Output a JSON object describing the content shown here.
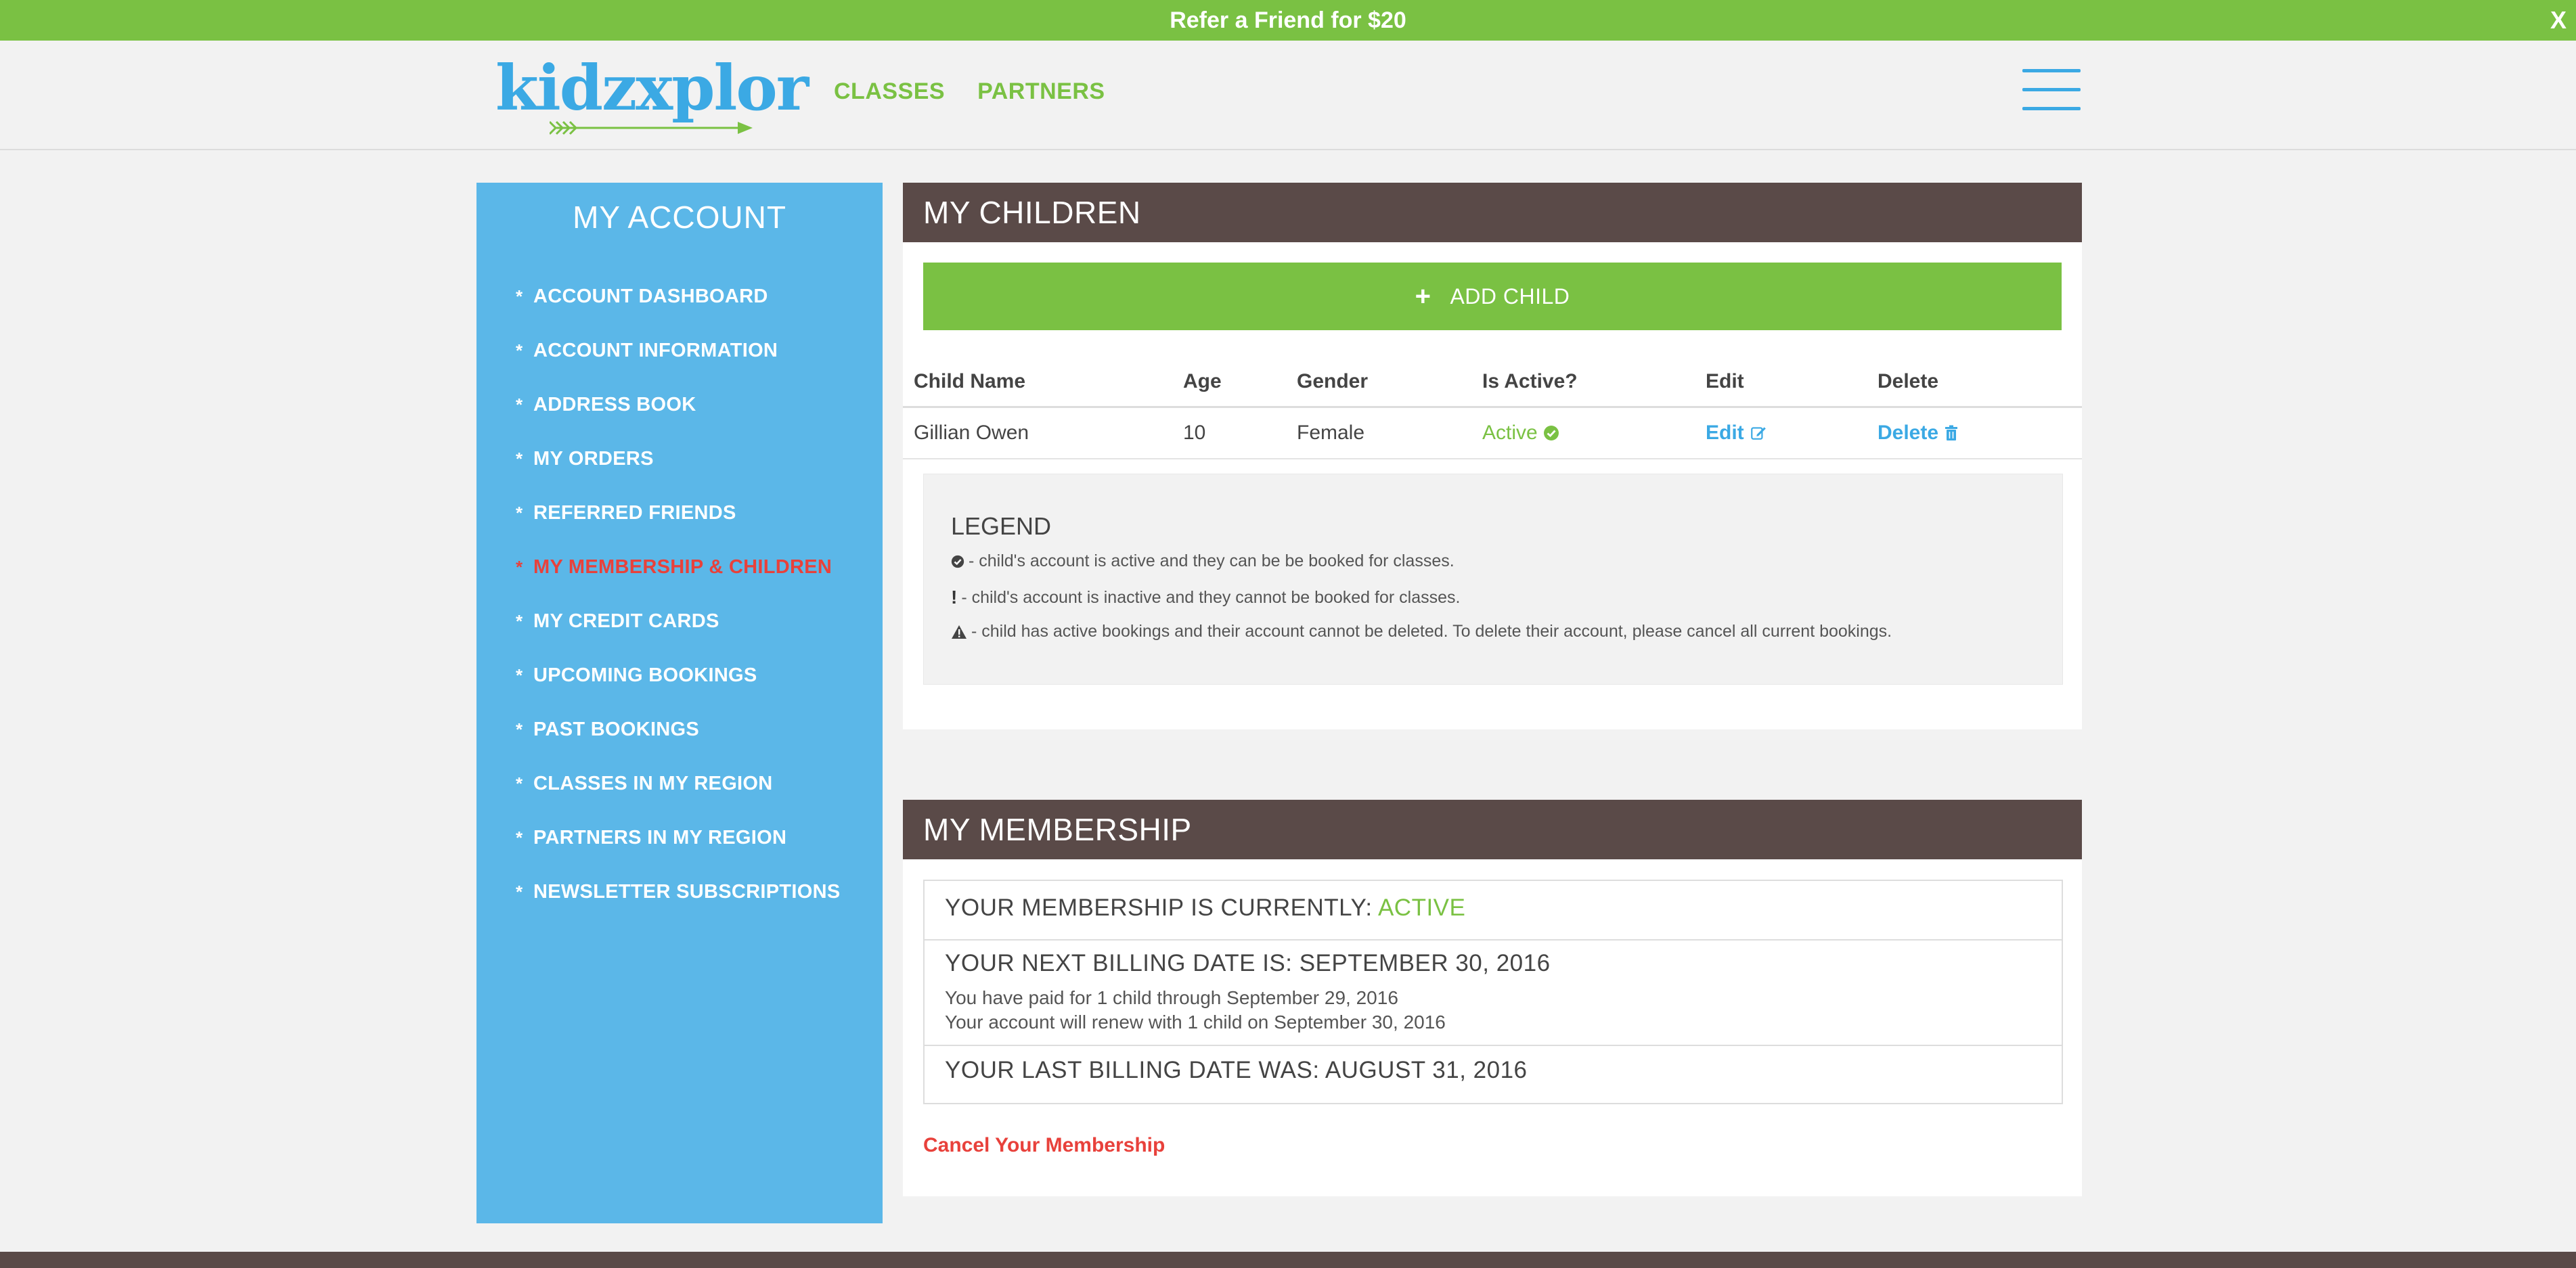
{
  "promo": {
    "text": "Refer a Friend for $20",
    "close": "X"
  },
  "header": {
    "logo": "kidzxplor",
    "nav": [
      "CLASSES",
      "PARTNERS"
    ]
  },
  "sidebar": {
    "title": "MY ACCOUNT",
    "bullet": "*",
    "items": [
      {
        "label": "ACCOUNT DASHBOARD"
      },
      {
        "label": "ACCOUNT INFORMATION"
      },
      {
        "label": "ADDRESS BOOK"
      },
      {
        "label": "MY ORDERS"
      },
      {
        "label": "REFERRED FRIENDS"
      },
      {
        "label": "MY MEMBERSHIP & CHILDREN"
      },
      {
        "label": "MY CREDIT CARDS"
      },
      {
        "label": "UPCOMING BOOKINGS"
      },
      {
        "label": "PAST BOOKINGS"
      },
      {
        "label": "CLASSES IN MY REGION"
      },
      {
        "label": "PARTNERS IN MY REGION"
      },
      {
        "label": "NEWSLETTER SUBSCRIPTIONS"
      }
    ]
  },
  "children": {
    "title": "MY CHILDREN",
    "add_button": "ADD CHILD",
    "add_plus": "+",
    "columns": [
      "Child Name",
      "Age",
      "Gender",
      "Is Active?",
      "Edit",
      "Delete"
    ],
    "rows": [
      {
        "name": "Gillian Owen",
        "age": "10",
        "gender": "Female",
        "active": "Active",
        "edit": "Edit",
        "delete": "Delete"
      }
    ],
    "legend": {
      "title": "LEGEND",
      "exclaim": "!",
      "lines": [
        "- child's account is active and they can be be booked for classes.",
        "- child's account is inactive and they cannot be booked for classes.",
        "- child has active bookings and their account cannot be deleted. To delete their account, please cancel all current bookings."
      ]
    }
  },
  "membership": {
    "title": "MY MEMBERSHIP",
    "status_label": "YOUR MEMBERSHIP IS CURRENTLY:",
    "status_value": "ACTIVE",
    "next_billing": "YOUR NEXT BILLING DATE IS: SEPTEMBER 30, 2016",
    "paid_line": "You have paid for 1 child through September 29, 2016",
    "renew_line": "Your account will renew with 1 child on September 30, 2016",
    "last_billing": "YOUR LAST BILLING DATE WAS: AUGUST 31, 2016",
    "cancel": "Cancel Your Membership"
  },
  "colors": {
    "brand_green": "#7ac143",
    "brand_blue": "#3ba9e4",
    "sidebar_blue": "#5bb7e8",
    "panel_header": "#5a4a48",
    "alert_red": "#e8413b"
  }
}
